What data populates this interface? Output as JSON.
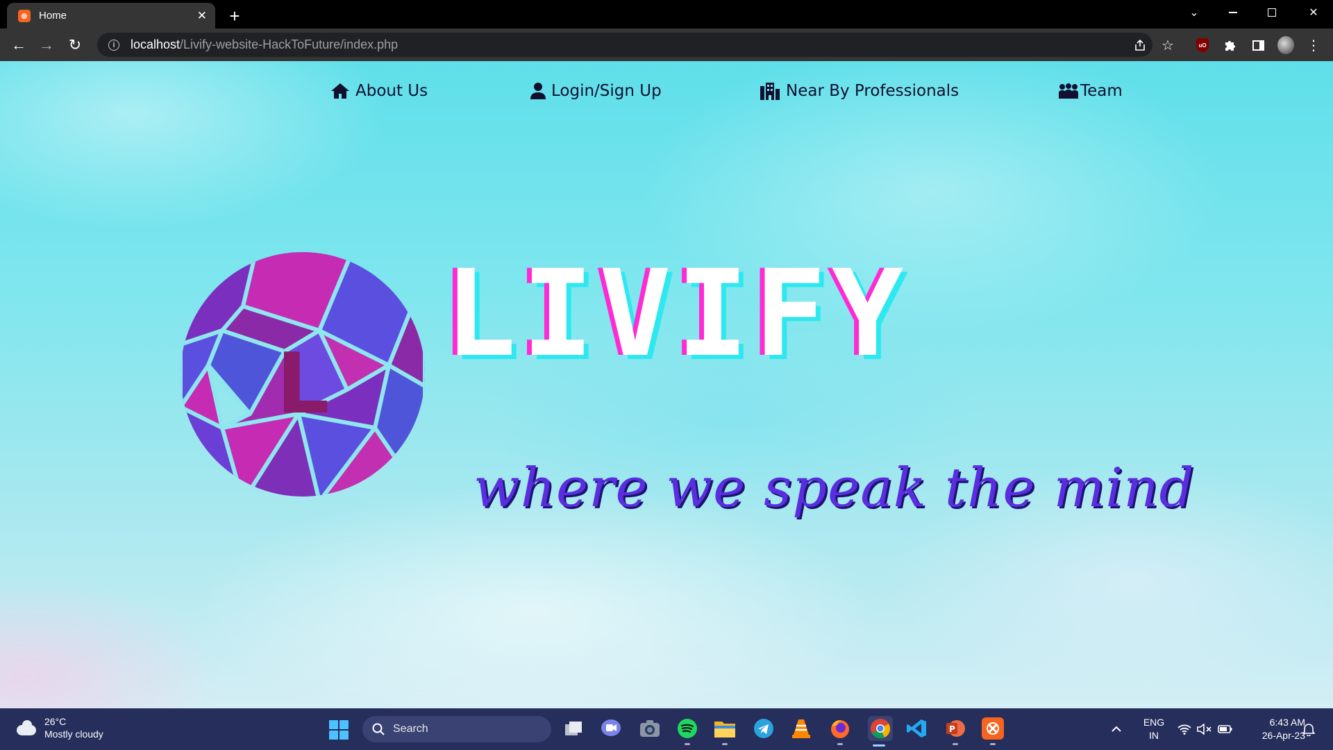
{
  "browser": {
    "tab_title": "Home",
    "url_host": "localhost",
    "url_path": "/Livify-website-HackToFuture/index.php"
  },
  "page": {
    "nav": [
      {
        "label": "About Us",
        "icon": "home-icon"
      },
      {
        "label": "Login/Sign Up",
        "icon": "user-icon"
      },
      {
        "label": "Near By Professionals",
        "icon": "building-icon"
      },
      {
        "label": "Team",
        "icon": "people-group-icon"
      }
    ],
    "brand_name": "LIVIFY",
    "logo_letter": "L",
    "tagline": "where we speak the mind",
    "colors": {
      "brand_pink": "#ff2ad4",
      "brand_cyan": "#2ee8f0",
      "tagline_purple": "#5a2ee0"
    }
  },
  "taskbar": {
    "weather_temp": "26°C",
    "weather_desc": "Mostly cloudy",
    "search_placeholder": "Search",
    "lang_top": "ENG",
    "lang_bottom": "IN",
    "time": "6:43 AM",
    "date": "26-Apr-23"
  }
}
